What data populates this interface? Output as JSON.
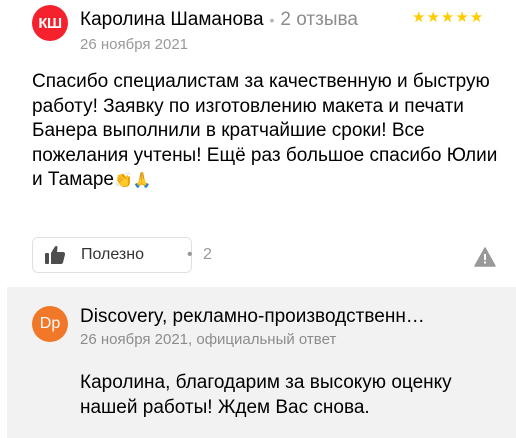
{
  "review": {
    "avatar_initials": "КШ",
    "author": "Каролина Шаманова",
    "separator": "•",
    "review_count": "2 отзыва",
    "date": "26 ноября 2021",
    "rating": 5,
    "stars": "★★★★★",
    "text": "Спасибо специалистам за качественную и быструю работу! Заявку по изготовлению макета и печати Банера выполнили в кратчайшие сроки! Все пожелания учтены! Ещё раз большое спасибо Юлии и Тамаре",
    "emoji": "👏🙏"
  },
  "actions": {
    "helpful_label": "Полезно",
    "helpful_separator": "•",
    "helpful_count": "2",
    "thumb_icon": "thumbs-up-icon",
    "report_icon": "warning-icon"
  },
  "reply": {
    "avatar_initials": "Dp",
    "org_name": "Discovery, рекламно-производственн…",
    "date_and_type": "26 ноября 2021, официальный ответ",
    "text": "Каролина, благодарим за высокую оценку нашей работы! Ждем Вас снова."
  },
  "colors": {
    "user_avatar": "#f5222d",
    "org_avatar": "#f07828",
    "stars": "#ffcc00",
    "reply_bg": "#f2f2f2"
  }
}
